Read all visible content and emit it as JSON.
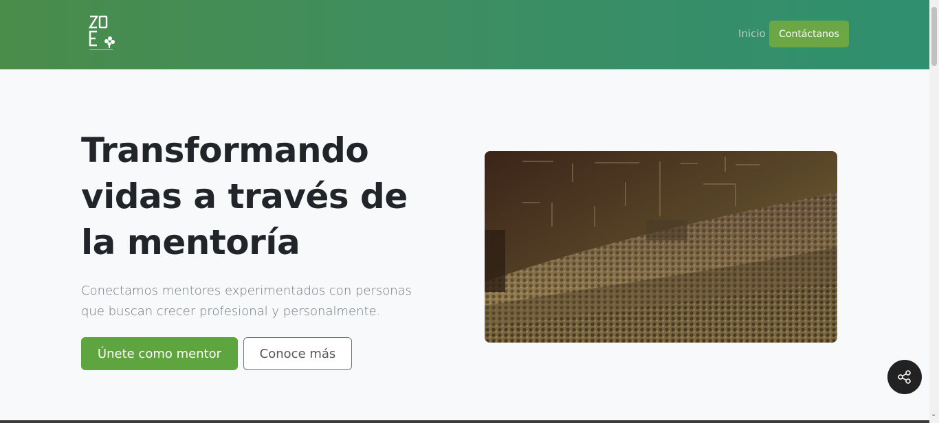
{
  "header": {
    "logo_alt": "ZOE",
    "nav": {
      "home_label": "Inicio",
      "contact_label": "Contáctanos"
    }
  },
  "hero": {
    "title": "Transformando vidas a través de la mentoría",
    "subtitle": "Conectamos mentores experimentados con personas que buscan crecer profesional y personalmente.",
    "primary_button": "Únete como mentor",
    "secondary_button": "Conoce más",
    "image_subject": "auditorium audience"
  },
  "floating": {
    "share_icon": "share-icon"
  },
  "colors": {
    "header_gradient_start": "#4a8c4a",
    "header_gradient_end": "#2f8f6f",
    "accent_green": "#5fa53f",
    "title_color": "#212529"
  }
}
